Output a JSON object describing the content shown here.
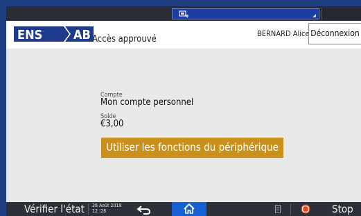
{
  "header": {
    "logo_left": "ENS",
    "logo_right": "AB",
    "access_status": "Accès approuvé",
    "user_name": "BERNARD Alice",
    "logout_label": "Déconnexion"
  },
  "main": {
    "account_label": "Compte",
    "account_value": "Mon compte personnel",
    "balance_label": "Solde",
    "balance_value": "€3,00",
    "use_functions_label": "Utiliser les fonctions du périphérique"
  },
  "bottom": {
    "check_status_label": "Vérifier l'état",
    "date": "26 Août 2019",
    "time": "12 :28",
    "stop_label": "Stop"
  },
  "icons": [
    "screen-icon",
    "back-arrow-icon",
    "home-icon",
    "document-icon",
    "stop-icon"
  ],
  "colors": {
    "bezel": "#1e3f82",
    "accent_button": "#c9901b",
    "home_active": "#1560d4",
    "stop_red": "#e24a1c"
  }
}
